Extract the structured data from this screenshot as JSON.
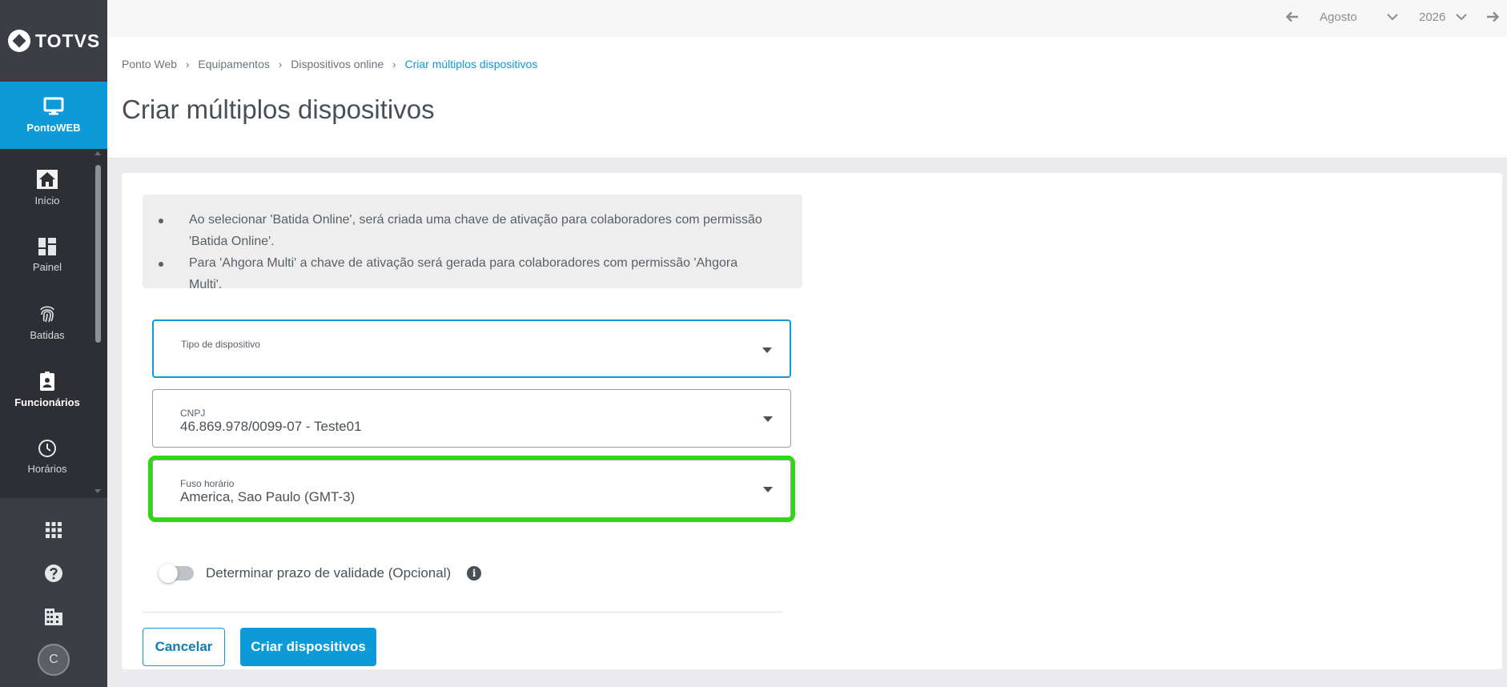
{
  "app": {
    "logo_text": "TOTVS"
  },
  "sidebar": {
    "brand": {
      "label": "PontoWEB",
      "icon": "monitor-icon"
    },
    "items": [
      {
        "label": "Início",
        "icon": "home-icon"
      },
      {
        "label": "Painel",
        "icon": "dashboard-icon"
      },
      {
        "label": "Batidas",
        "icon": "fingerprint-icon"
      },
      {
        "label": "Funcionários",
        "icon": "badge-icon",
        "active": true
      },
      {
        "label": "Horários",
        "icon": "clock-icon"
      }
    ],
    "bottom": [
      {
        "icon": "apps-grid-icon"
      },
      {
        "icon": "help-icon"
      },
      {
        "icon": "building-icon"
      }
    ],
    "avatar_initial": "C"
  },
  "topbar": {
    "month": "Agosto",
    "year": "2026"
  },
  "breadcrumb": [
    "Ponto Web",
    "Equipamentos",
    "Dispositivos online",
    "Criar múltiplos dispositivos"
  ],
  "page_title": "Criar múltiplos dispositivos",
  "info": {
    "bullets": [
      "Ao selecionar 'Batida Online', será criada uma chave de ativação para colaboradores com permissão 'Batida Online'.",
      "Para 'Ahgora Multi' a chave de ativação será gerada para colaboradores com permissão 'Ahgora Multi'."
    ]
  },
  "form": {
    "device_type": {
      "label": "Tipo de dispositivo",
      "value": ""
    },
    "cnpj": {
      "label": "CNPJ",
      "value": "46.869.978/0099-07 - Teste01"
    },
    "timezone": {
      "label": "Fuso horário",
      "value": "America, Sao Paulo (GMT-3)"
    },
    "validity_toggle": {
      "label": "Determinar prazo de validade (Opcional)",
      "on": false
    }
  },
  "actions": {
    "cancel": "Cancelar",
    "create": "Criar dispositivos"
  },
  "colors": {
    "accent": "#0c9ad8",
    "highlight": "#2cdb0f",
    "sidebar": "#2d2f34"
  }
}
